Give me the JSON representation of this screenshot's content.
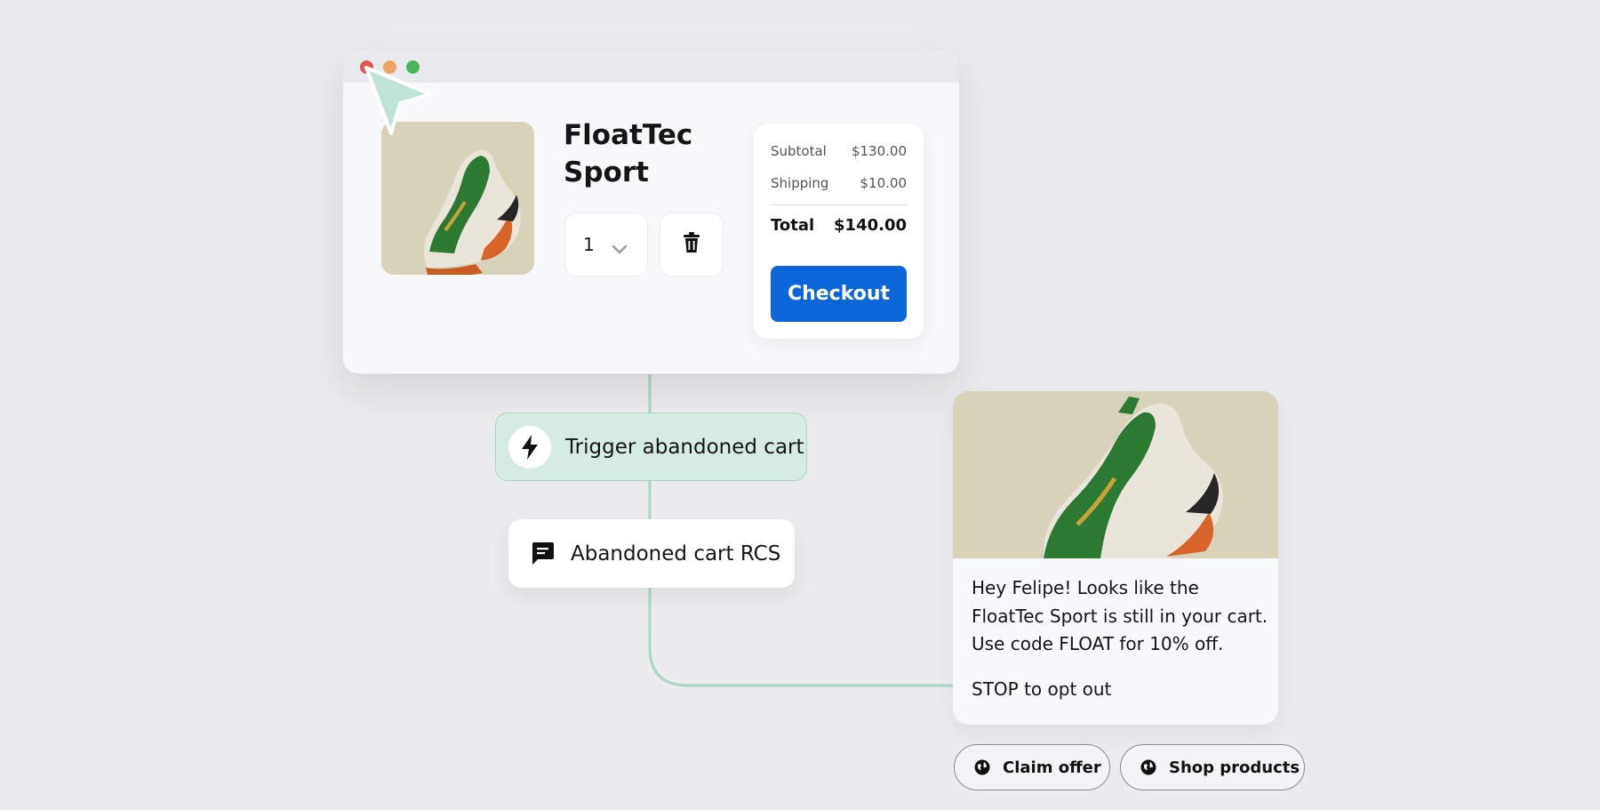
{
  "product": {
    "name": "FloatTec Sport",
    "image": "green-sneaker-photo",
    "quantity": "1"
  },
  "summary": {
    "subtotal_label": "Subtotal",
    "subtotal_value": "$130.00",
    "shipping_label": "Shipping",
    "shipping_value": "$10.00",
    "total_label": "Total",
    "total_value": "$140.00",
    "checkout_label": "Checkout"
  },
  "flow": {
    "trigger_label": "Trigger abandoned cart",
    "trigger_icon": "lightning-icon",
    "rcs_label": "Abandoned cart RCS",
    "rcs_icon": "chat-bubble-icon"
  },
  "message": {
    "image": "green-sneaker-photo",
    "body": "Hey Felipe! Looks like the FloatTec Sport is still in your cart. Use code FLOAT for 10% off.",
    "opt_out": "STOP to opt out",
    "actions": [
      {
        "label": "Claim offer",
        "icon": "globe-icon"
      },
      {
        "label": "Shop products",
        "icon": "globe-icon"
      }
    ]
  },
  "colors": {
    "accent": "#0c66d9",
    "trigger_bg": "#d6ebe2",
    "connector": "#a9d6c4",
    "window_red": "#e0564f",
    "window_orange": "#f0a060",
    "window_green": "#4bb55b"
  }
}
